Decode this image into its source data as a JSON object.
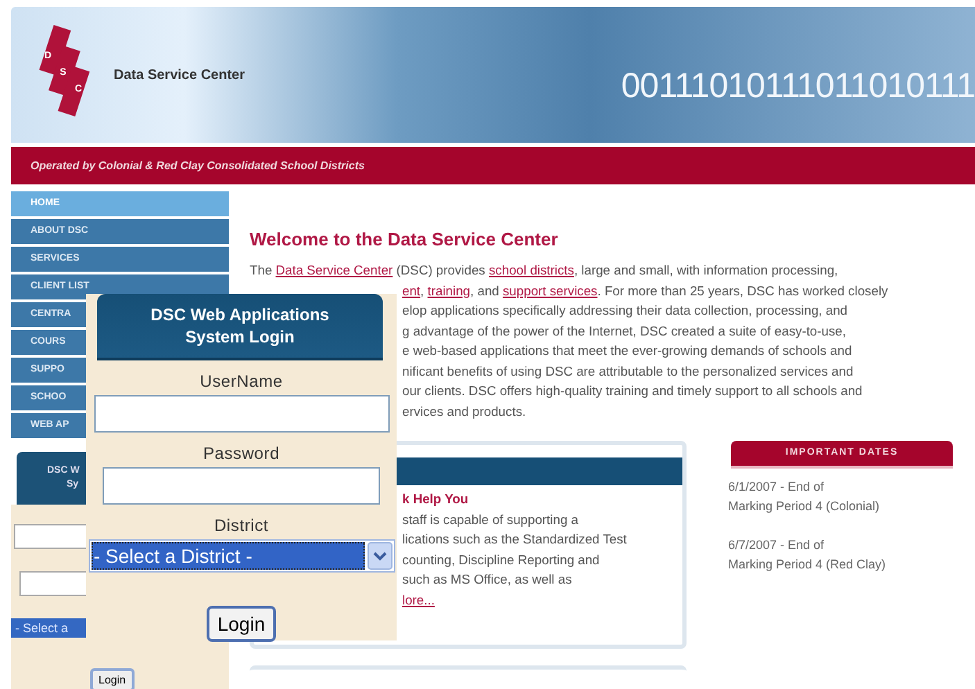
{
  "header": {
    "logo_letters": [
      "D",
      "S",
      "C"
    ],
    "site_name": "Data Service Center",
    "binary_text": "00111010111011010111",
    "tagline": "Operated by Colonial & Red Clay Consolidated School Districts"
  },
  "sidebar": {
    "items": [
      {
        "label": "HOME",
        "selected": true
      },
      {
        "label": "ABOUT DSC",
        "selected": false
      },
      {
        "label": "SERVICES",
        "selected": false
      },
      {
        "label": "CLIENT LIST",
        "selected": false
      },
      {
        "label": "CENTRA",
        "selected": false
      },
      {
        "label": "COURS",
        "selected": false
      },
      {
        "label": "SUPPO",
        "selected": false
      },
      {
        "label": "SCHOO",
        "selected": false
      },
      {
        "label": "WEB AP",
        "selected": false
      }
    ],
    "mini_login": {
      "title_lines": [
        "DSC W",
        "Sy"
      ],
      "district_value": "- Select a",
      "button": "Login"
    }
  },
  "content": {
    "title": "Welcome to the Data Service Center",
    "paragraph_lines": [
      {
        "covered": false,
        "segments": [
          {
            "text": "The ",
            "link": false
          },
          {
            "text": "Data Service Center",
            "link": true
          },
          {
            "text": " (DSC) provides ",
            "link": false
          },
          {
            "text": "school districts",
            "link": true
          },
          {
            "text": ", large and small, with information processing,",
            "link": false
          }
        ]
      },
      {
        "covered": true,
        "segments": [
          {
            "text": "ent",
            "link": true
          },
          {
            "text": ", ",
            "link": false
          },
          {
            "text": "training",
            "link": true
          },
          {
            "text": ", and ",
            "link": false
          },
          {
            "text": "support services",
            "link": true
          },
          {
            "text": ". For more than 25 years, DSC has worked closely",
            "link": false
          }
        ]
      },
      {
        "covered": true,
        "segments": [
          {
            "text": "elop applications specifically addressing their data collection, processing, and",
            "link": false
          }
        ]
      },
      {
        "covered": true,
        "segments": [
          {
            "text": "g advantage of the power of the Internet, DSC created a suite of easy-to-use,",
            "link": false
          }
        ]
      },
      {
        "covered": true,
        "segments": [
          {
            "text": "e web-based applications that meet the ever-growing demands of schools and",
            "link": false
          }
        ]
      },
      {
        "covered": true,
        "segments": [
          {
            "text": "nificant benefits of using DSC are attributable to the personalized services and",
            "link": false
          }
        ]
      },
      {
        "covered": true,
        "segments": [
          {
            "text": "our clients. DSC offers high-quality training and timely support to all schools and",
            "link": false
          }
        ]
      },
      {
        "covered": true,
        "segments": [
          {
            "text": "ervices and products.",
            "link": false
          }
        ]
      }
    ],
    "feature_box": {
      "lines": [
        {
          "kind": "heading",
          "text": "k Help You"
        },
        {
          "kind": "text",
          "text": "staff is capable of supporting a"
        },
        {
          "kind": "text",
          "text": "lications such as the Standardized Test"
        },
        {
          "kind": "text",
          "text": "counting, Discipline Reporting and"
        },
        {
          "kind": "text",
          "text": "such as MS Office, as well as"
        },
        {
          "kind": "link",
          "text": "lore..."
        }
      ]
    },
    "important_dates": {
      "title": "IMPORTANT DATES",
      "entries": [
        {
          "date": "6/1/2007 - End of",
          "detail": "Marking Period 4 (Colonial)"
        },
        {
          "date": "6/7/2007 - End of",
          "detail": "Marking Period 4 (Red Clay)"
        }
      ]
    }
  },
  "login_popup": {
    "title_lines": [
      "DSC Web Applications",
      "System Login"
    ],
    "username_label": "UserName",
    "password_label": "Password",
    "district_label": "District",
    "district_value": "- Select a District -",
    "button": "Login"
  }
}
